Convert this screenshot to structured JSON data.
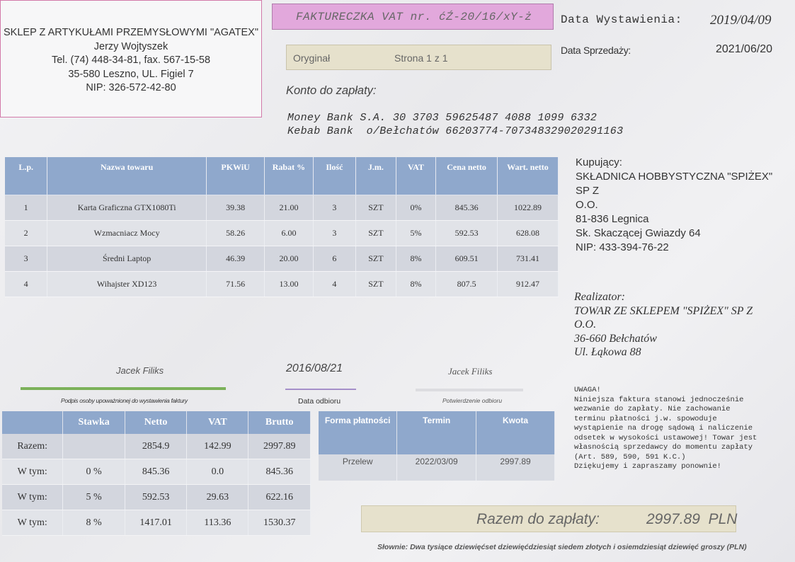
{
  "seller": {
    "name": "SKLEP Z ARTYKUŁAMI PRZEMYSŁOWYMI \"AGATEX\"",
    "person": "Jerzy Wojtyszek",
    "phone": "Tel. (74) 448-34-81, fax. 567-15-58",
    "address": "35-580 Leszno, UL. Figiel 7",
    "nip": "NIP: 326-572-42-80"
  },
  "invoice": {
    "title": "FAKTURECZKA VAT nr. ćŹ-20/16/xY-ż",
    "issue_label": "Data Wystawienia:",
    "issue_date": "2019/04/09",
    "sale_label": "Data Sprzedaży:",
    "sale_date": "2021/06/20",
    "original": "Oryginał",
    "page": "Strona 1 z 1"
  },
  "account": {
    "label": "Konto do zapłaty:",
    "line1": "Money Bank S.A. 30 3703 59625487 4088 1099 6332",
    "line2": "Kebab Bank  o/Bełchatów 66203774-707348329020291163"
  },
  "items_table": {
    "headers": [
      "L.p.",
      "Nazwa towaru",
      "PKWiU",
      "Rabat %",
      "Ilość",
      "J.m.",
      "VAT",
      "Cena netto",
      "Wart. netto"
    ],
    "rows": [
      [
        "1",
        "Karta Graficzna  GTX1080Ti",
        "39.38",
        "21.00",
        "3",
        "SZT",
        "0%",
        "845.36",
        "1022.89"
      ],
      [
        "2",
        "Wzmacniacz  Mocy",
        "58.26",
        "6.00",
        "3",
        "SZT",
        "5%",
        "592.53",
        "628.08"
      ],
      [
        "3",
        "Średni Laptop",
        "46.39",
        "20.00",
        "6",
        "SZT",
        "8%",
        "609.51",
        "731.41"
      ],
      [
        "4",
        "Wihajster XD123",
        "71.56",
        "13.00",
        "4",
        "SZT",
        "8%",
        "807.5",
        "912.47"
      ]
    ]
  },
  "buyer": {
    "label": "Kupujący:",
    "name1": "SKŁADNICA HOBBYSTYCZNA \"SPIŻEX\" SP Z",
    "name2": "O.O.",
    "city": "81-836 Legnica",
    "street": "Sk. Skaczącej Gwiazdy 64",
    "nip": "NIP: 433-394-76-22"
  },
  "realizator": {
    "label": "Realizator:",
    "name1": "TOWAR ZE SKLEPEM \"SPIŻEX\" SP Z",
    "name2": "O.O.",
    "city": "36-660 Bełchatów",
    "street": "Ul. Łąkowa 88"
  },
  "signatures": {
    "left_name": "Jacek Filiks",
    "left_caption": "Podpis osoby upoważnionej do wystawienia faktury",
    "date": "2016/08/21",
    "date_caption": "Data odbioru",
    "right_name": "Jacek Filiks",
    "right_caption": "Potwierdzenie odbioru"
  },
  "notice": "UWAGA!\nNiniejsza faktura stanowi jednocześnie\nwezwanie do zapłaty. Nie zachowanie\nterminu płatności j.w. spowoduje\nwystąpienie na drogę sądową i naliczenie\nodsetek w wysokości ustawowej! Towar jest\nwłasnością sprzedawcy do momentu zapłaty\n(Art. 589, 590, 591 K.C.)\nDziękujemy i zapraszamy ponownie!",
  "vat_table": {
    "headers": [
      "",
      "Stawka",
      "Netto",
      "VAT",
      "Brutto"
    ],
    "rows": [
      [
        "Razem:",
        "",
        "2854.9",
        "142.99",
        "2997.89"
      ],
      [
        "W tym:",
        "0 %",
        "845.36",
        "0.0",
        "845.36"
      ],
      [
        "W tym:",
        "5 %",
        "592.53",
        "29.63",
        "622.16"
      ],
      [
        "W tym:",
        "8 %",
        "1417.01",
        "113.36",
        "1530.37"
      ]
    ]
  },
  "payment_table": {
    "headers": [
      "Forma płatności",
      "Termin",
      "Kwota"
    ],
    "row": [
      "Przelew",
      "2022/03/09",
      "2997.89"
    ]
  },
  "total": {
    "label": "Razem do zapłaty:",
    "amount": "2997.89  PLN"
  },
  "slownie": "Słownie: Dwa tysiące dziewięćset dziewięćdziesiąt siedem złotych i osiemdziesiąt dziewięć groszy (PLN)",
  "colors": {
    "table_header": "#8fa8cc",
    "title_box": "#e2a8dc",
    "beige_box": "#e6e1cc",
    "signature_line_green": "#7cb15a",
    "signature_line_purple": "#a58fc9"
  }
}
